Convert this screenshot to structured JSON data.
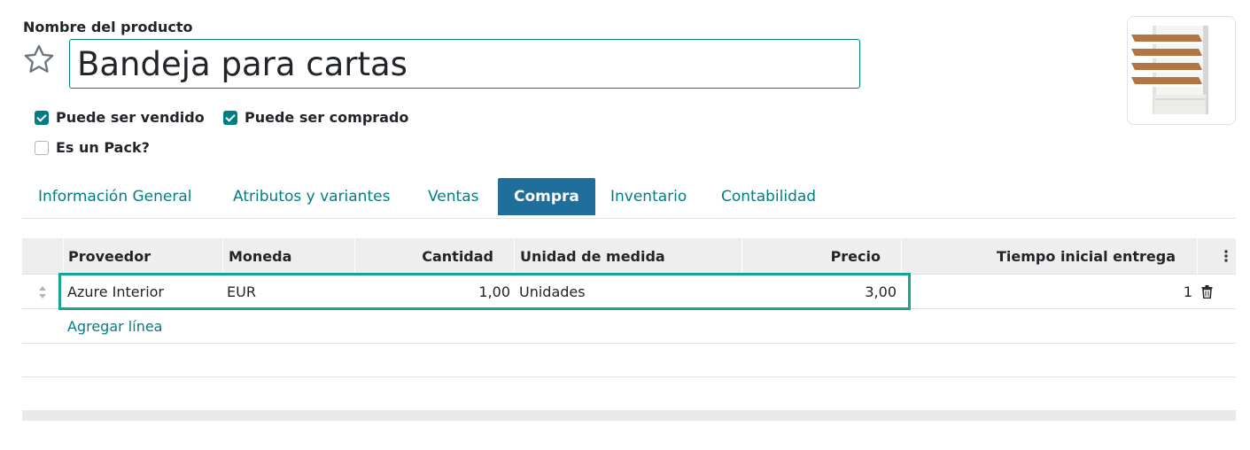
{
  "product": {
    "name_label": "Nombre del producto",
    "name_value": "Bandeja para cartas",
    "favorite_icon": "star-icon",
    "image_alt": "letter-tray-image"
  },
  "options": {
    "can_be_sold": {
      "label": "Puede ser vendido",
      "checked": true
    },
    "can_be_purchased": {
      "label": "Puede ser comprado",
      "checked": true
    },
    "is_pack": {
      "label": "Es un Pack?",
      "checked": false
    }
  },
  "tabs": [
    {
      "label": "Información General",
      "active": false
    },
    {
      "label": "Atributos y variantes",
      "active": false
    },
    {
      "label": "Ventas",
      "active": false
    },
    {
      "label": "Compra",
      "active": true
    },
    {
      "label": "Inventario",
      "active": false
    },
    {
      "label": "Contabilidad",
      "active": false
    }
  ],
  "vendor_table": {
    "columns": [
      "Proveedor",
      "Moneda",
      "Cantidad",
      "Unidad de medida",
      "Precio",
      "Tiempo inicial entrega"
    ],
    "rows": [
      {
        "vendor": "Azure Interior",
        "currency": "EUR",
        "quantity": "1,00",
        "uom": "Unidades",
        "price": "3,00",
        "lead_time": "1"
      }
    ],
    "add_line": "Agregar línea"
  },
  "colors": {
    "accent": "#017e84",
    "active_tab": "#1f6e9c",
    "highlight": "#16a398"
  }
}
